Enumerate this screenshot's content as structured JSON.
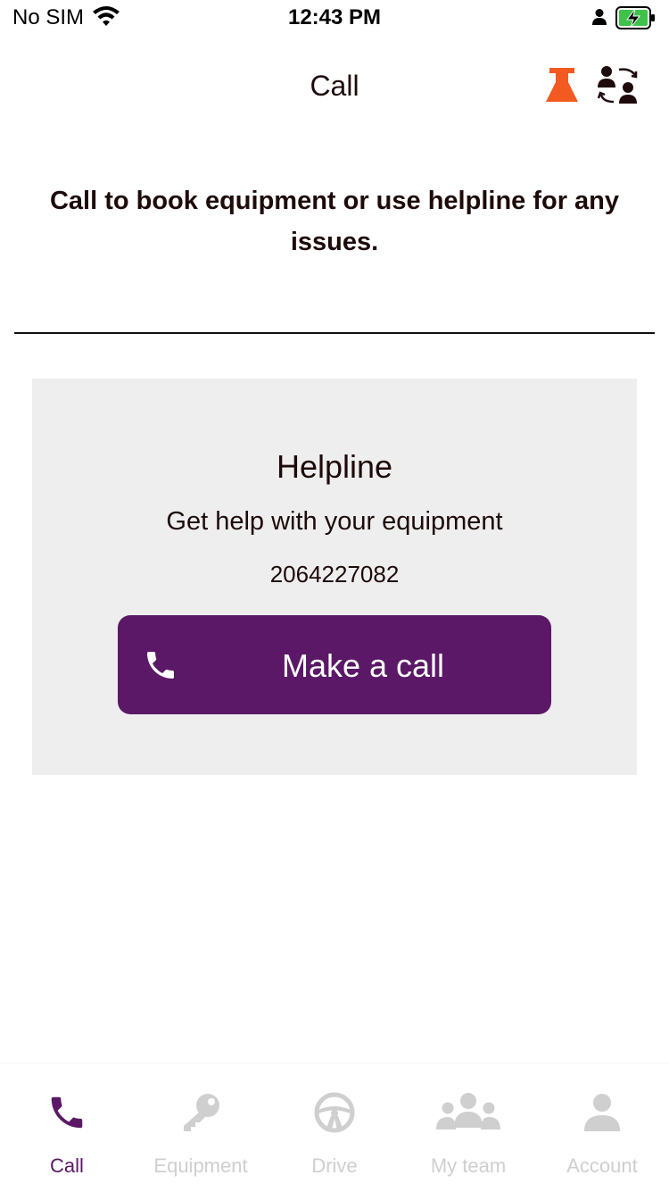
{
  "status_bar": {
    "carrier": "No SIM",
    "time": "12:43 PM",
    "icons": [
      "wifi-icon",
      "person-icon",
      "battery-charging-icon"
    ]
  },
  "nav": {
    "title": "Call",
    "icons": [
      "lab-flask-icon",
      "switch-user-icon"
    ],
    "lab_icon_color": "#f25a22"
  },
  "intro": {
    "text": "Call to book equipment or use helpline for any issues."
  },
  "helpline": {
    "title": "Helpline",
    "subtitle": "Get help with your equipment",
    "phone": "2064227082",
    "button_label": "Make a call",
    "button_color": "#5a1866",
    "card_color": "#efeeee"
  },
  "tabs": [
    {
      "label": "Call",
      "icon": "phone-icon",
      "active": true
    },
    {
      "label": "Equipment",
      "icon": "key-icon",
      "active": false
    },
    {
      "label": "Drive",
      "icon": "steering-wheel-icon",
      "active": false
    },
    {
      "label": "My team",
      "icon": "team-icon",
      "active": false
    },
    {
      "label": "Account",
      "icon": "account-icon",
      "active": false
    }
  ],
  "colors": {
    "active_tab": "#5a1866",
    "inactive_tab": "#cfcfcf",
    "text": "#1e0a0a"
  }
}
